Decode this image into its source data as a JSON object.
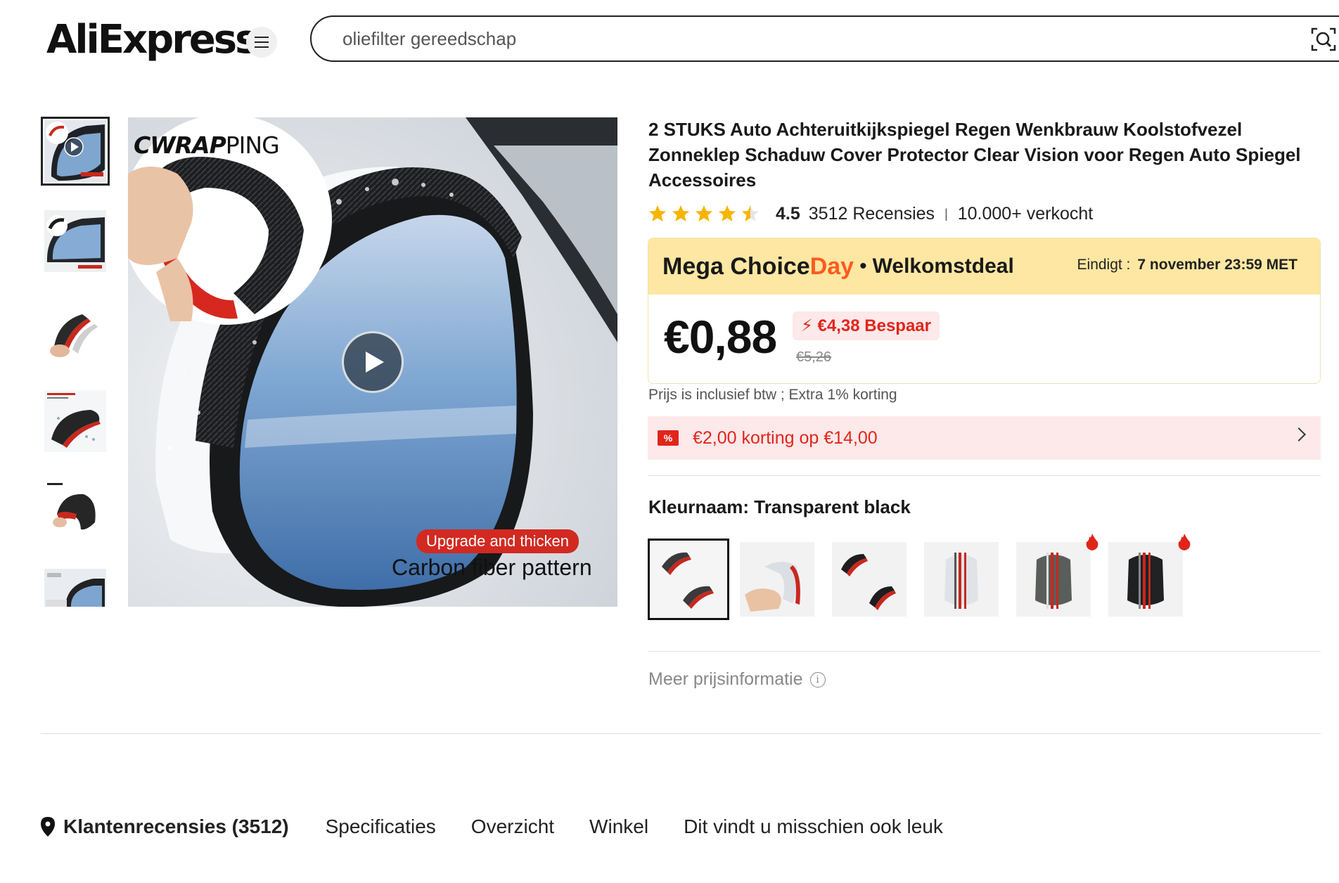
{
  "header": {
    "logo_text": "AliExpress",
    "search_placeholder": "oliefilter gereedschap",
    "brand_color": "#ff6a00"
  },
  "gallery": {
    "brand_text_bold": "CWRAP",
    "brand_text_thin": "PING",
    "badge_text": "Upgrade and thicken",
    "caption": "Carbon fiber pattern",
    "thumbnail_count": 6
  },
  "product": {
    "title": "2 STUKS Auto Achteruitkijkspiegel Regen Wenkbrauw Koolstofvezel Zonneklep Schaduw Cover Protector Clear Vision voor Regen Auto Spiegel Accessoires",
    "rating": "4.5",
    "rating_value": 4.5,
    "reviews": "3512 Recensies",
    "sold": "10.000+ verkocht"
  },
  "deal": {
    "mega": "Mega Choice",
    "day": "Day",
    "dot": "•",
    "welcome": "Welkomstdeal",
    "ends_label": "Eindigt :",
    "ends_value": "7 november 23:59 MET",
    "price": "€0,88",
    "save": "€4,38 Bespaar",
    "old_price": "€5,26",
    "accent_color": "#e1251b",
    "header_color": "#fde7a2"
  },
  "vat_note": "Prijs is inclusief btw ; Extra 1% korting",
  "coupon": {
    "icon": "%",
    "text": "€2,00 korting op €14,00"
  },
  "variant": {
    "label": "Kleurnaam: Transparent black",
    "swatches": [
      {
        "name": "transparent-black",
        "selected": true,
        "hot": false
      },
      {
        "name": "transparent-clear",
        "selected": false,
        "hot": false
      },
      {
        "name": "carbon-pair",
        "selected": false,
        "hot": false
      },
      {
        "name": "clear-tall",
        "selected": false,
        "hot": false
      },
      {
        "name": "smoke-tall",
        "selected": true,
        "hot": true
      },
      {
        "name": "black-tall",
        "selected": false,
        "hot": true
      }
    ]
  },
  "more_info": "Meer prijsinformatie",
  "tabs": [
    {
      "label": "Klantenrecensies (3512)"
    },
    {
      "label": "Specificaties"
    },
    {
      "label": "Overzicht"
    },
    {
      "label": "Winkel"
    },
    {
      "label": "Dit vindt u misschien ook leuk"
    }
  ]
}
